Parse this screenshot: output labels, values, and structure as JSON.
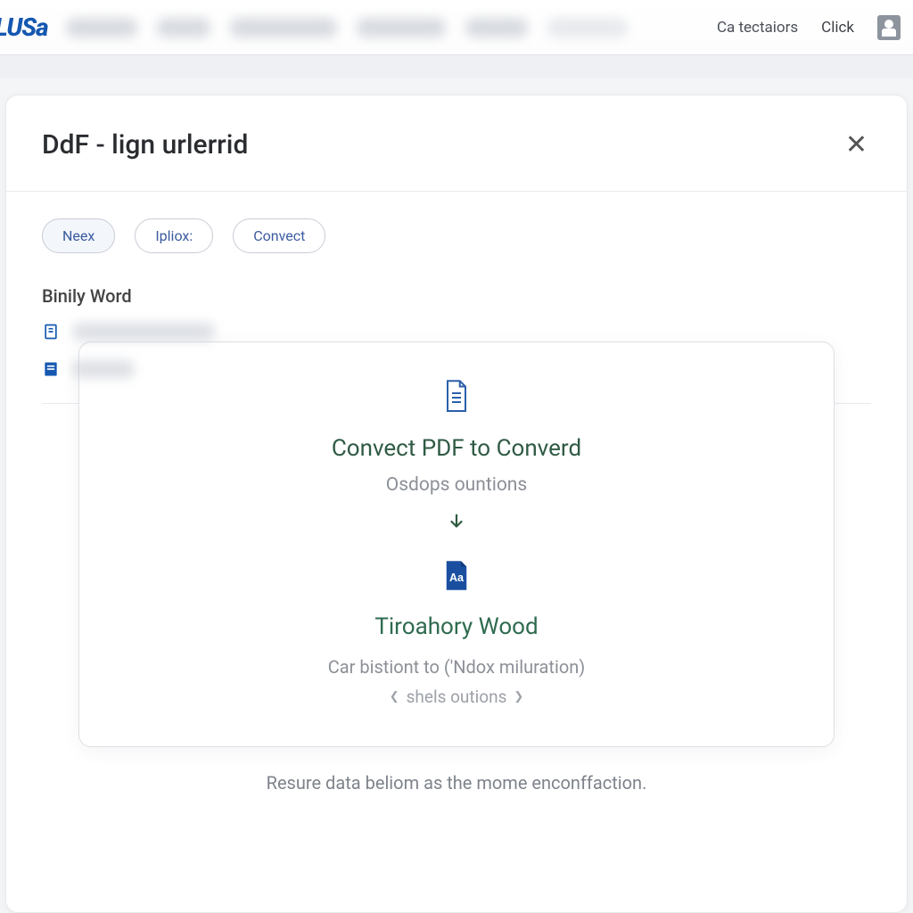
{
  "topbar": {
    "logo": "LUSa",
    "link_a": "Ca tectaiors",
    "link_b": "Click"
  },
  "panel": {
    "title": "DdF - lign urlerrid"
  },
  "tabs": {
    "a": "Neex",
    "b": "Ipliox:",
    "c": "Convect"
  },
  "section": {
    "label": "Binily Word"
  },
  "card": {
    "h1": "Convect PDF to Converd",
    "sub1": "Osdops ountions",
    "h2": "Tiroahory Wood",
    "line": "Car bistiont to ('Ndox miluration)",
    "small": "shels outions"
  },
  "footer": "Resure data beliom as the mome enconffaction."
}
